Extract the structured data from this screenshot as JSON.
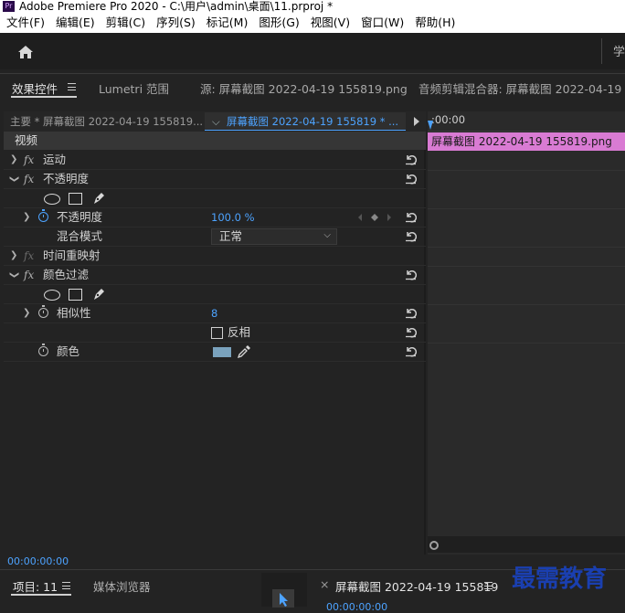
{
  "window": {
    "title": "Adobe Premiere Pro 2020 - C:\\用户\\admin\\桌面\\11.prproj *",
    "app_icon": "Pr"
  },
  "menu": [
    "文件(F)",
    "编辑(E)",
    "剪辑(C)",
    "序列(S)",
    "标记(M)",
    "图形(G)",
    "视图(V)",
    "窗口(W)",
    "帮助(H)"
  ],
  "workspace_label": "学",
  "tabs": {
    "effect_controls": "效果控件",
    "lumetri_scopes": "Lumetri 范围",
    "source": "源: 屏幕截图 2022-04-19 155819.png",
    "audio_mixer": "音频剪辑混合器: 屏幕截图 2022-04-19"
  },
  "clip_header": {
    "master": "主要 * 屏幕截图 2022-04-19 155819...",
    "clip": "屏幕截图 2022-04-19 155819 * ..."
  },
  "effects": {
    "video_label": "视频",
    "motion": "运动",
    "opacity": "不透明度",
    "opacity_prop": "不透明度",
    "opacity_value": "100.0 %",
    "blend_mode_label": "混合模式",
    "blend_mode_value": "正常",
    "time_remap": "时间重映射",
    "color_key": "颜色过滤",
    "similarity_label": "相似性",
    "similarity_value": "8",
    "invert_label": "反相",
    "invert_checked": false,
    "color_label": "颜色",
    "color_value": "#7aa2bd"
  },
  "timeline": {
    "ruler_time": ":00:00",
    "clip_name": "屏幕截图 2022-04-19 155819.png",
    "clip_color": "#d97bd3"
  },
  "timecode": "00:00:00:00",
  "bottom": {
    "project_tab": "项目: 11",
    "media_browser_tab": "媒体浏览器",
    "sequence_tab": "屏幕截图 2022-04-19 155819",
    "sequence_close": "×",
    "sequence_timecode": "00:00:00:00"
  },
  "watermark": "最需教育"
}
